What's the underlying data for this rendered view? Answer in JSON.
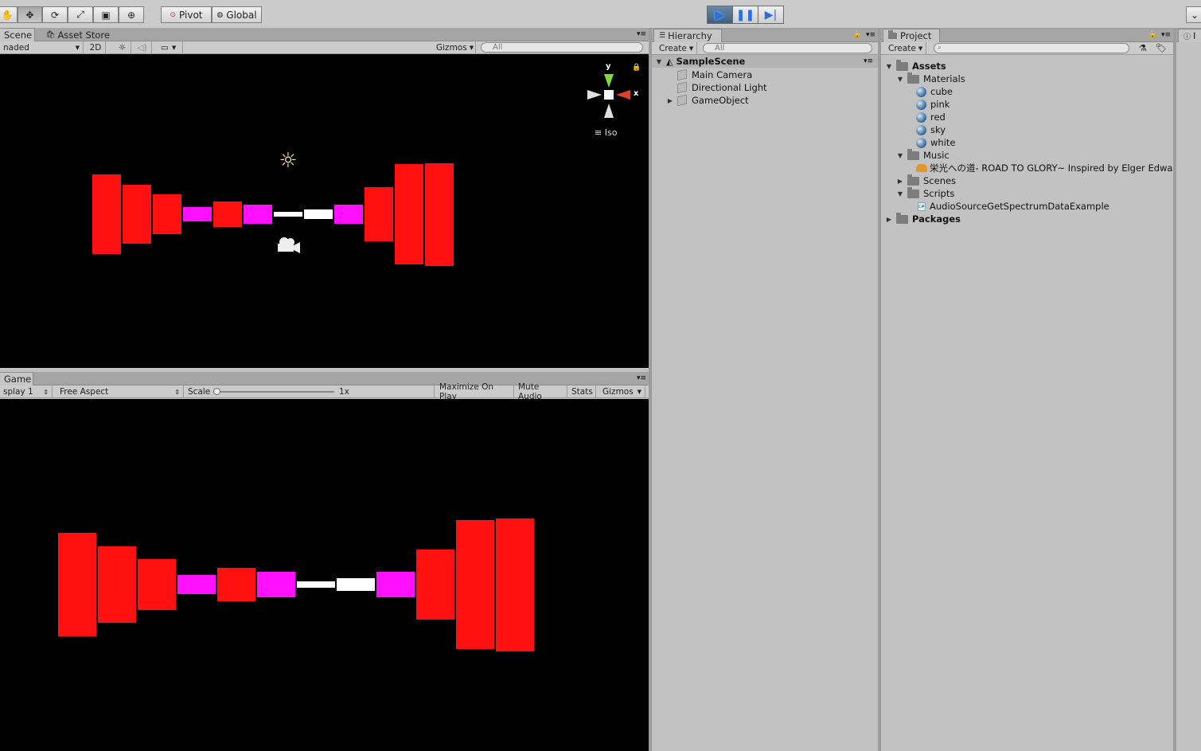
{
  "toolbar": {
    "tools": [
      "hand-icon",
      "move-icon",
      "rotate-icon",
      "scale-icon",
      "rect-icon",
      "transform-icon"
    ],
    "pivot_label": "Pivot",
    "global_label": "Global"
  },
  "scene": {
    "tabs": [
      "Scene",
      "Asset Store"
    ],
    "shading_label": "naded",
    "mode_2d_label": "2D",
    "gizmos_label": "Gizmos",
    "search_placeholder": "All",
    "axis_y": "y",
    "axis_x": "x",
    "projection_label": "Iso",
    "bars": [
      {
        "color": "#ff1111",
        "height_norm": 0.78
      },
      {
        "color": "#ff1111",
        "height_norm": 0.58
      },
      {
        "color": "#ff1111",
        "height_norm": 0.38
      },
      {
        "color": "#ff11ff",
        "height_norm": 0.14
      },
      {
        "color": "#ff1111",
        "height_norm": 0.25
      },
      {
        "color": "#ff11ff",
        "height_norm": 0.19
      },
      {
        "color": "#ffffff",
        "height_norm": 0.05
      },
      {
        "color": "#ffffff",
        "height_norm": 0.1
      },
      {
        "color": "#ff11ff",
        "height_norm": 0.19
      },
      {
        "color": "#ff1111",
        "height_norm": 0.53
      },
      {
        "color": "#ff1111",
        "height_norm": 0.97
      },
      {
        "color": "#ff1111",
        "height_norm": 1.0
      }
    ]
  },
  "game": {
    "tab": "Game",
    "display_label": "splay 1",
    "aspect_label": "Free Aspect",
    "scale_label": "Scale",
    "scale_value": "1x",
    "maximize_label": "Maximize On Play",
    "mute_label": "Mute Audio",
    "stats_label": "Stats",
    "gizmos_label": "Gizmos"
  },
  "hierarchy": {
    "tab": "Hierarchy",
    "create_label": "Create",
    "search_placeholder": "All",
    "scene_name": "SampleScene",
    "items": [
      "Main Camera",
      "Directional Light",
      "GameObject"
    ]
  },
  "project": {
    "tab": "Project",
    "create_label": "Create",
    "assets_label": "Assets",
    "materials_label": "Materials",
    "materials": [
      "cube",
      "pink",
      "red",
      "sky",
      "white"
    ],
    "music_label": "Music",
    "music_file": "栄光への道- ROAD TO GLORY~ Inspired by Elger Edwa",
    "scenes_label": "Scenes",
    "scripts_label": "Scripts",
    "script_file": "AudioSourceGetSpectrumDataExample",
    "packages_label": "Packages"
  },
  "inspector": {
    "tab": "I"
  }
}
